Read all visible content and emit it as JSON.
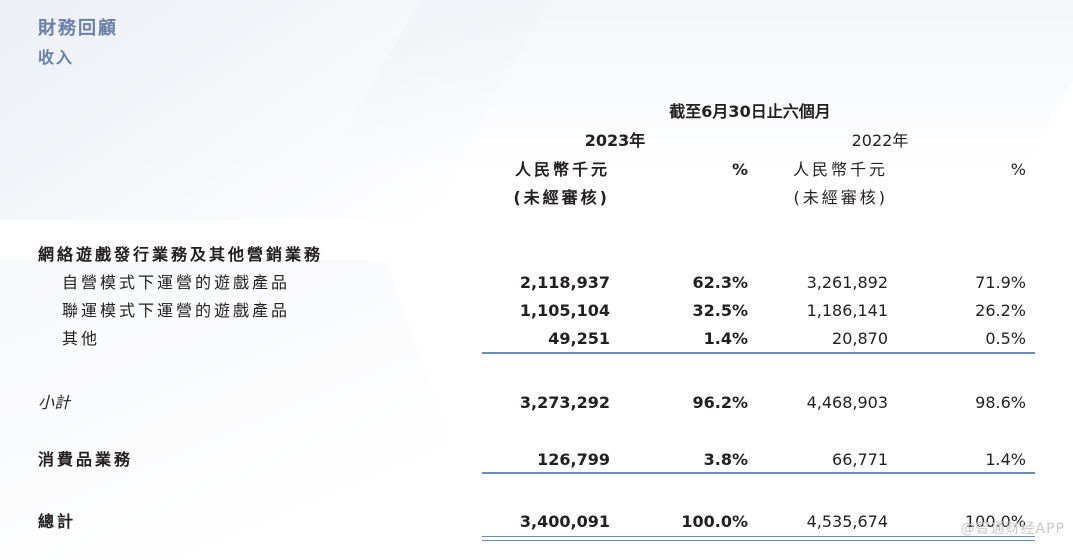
{
  "header": {
    "title": "財務回顧",
    "subtitle": "收入"
  },
  "table": {
    "period_header": "截至6月30日止六個月",
    "year_2023": "2023年",
    "year_2022": "2022年",
    "currency_label": "人民幣千元",
    "unaudited_label": "(未經審核)",
    "pct_label": "%",
    "section_label": "網絡遊戲發行業務及其他營銷業務",
    "rows": [
      {
        "label": "自營模式下運營的遊戲產品",
        "v2023": "2,118,937",
        "p2023": "62.3%",
        "v2022": "3,261,892",
        "p2022": "71.9%"
      },
      {
        "label": "聯運模式下運營的遊戲產品",
        "v2023": "1,105,104",
        "p2023": "32.5%",
        "v2022": "1,186,141",
        "p2022": "26.2%"
      },
      {
        "label": "其他",
        "v2023": "49,251",
        "p2023": "1.4%",
        "v2022": "20,870",
        "p2022": "0.5%"
      },
      {
        "label": "小計",
        "v2023": "3,273,292",
        "p2023": "96.2%",
        "v2022": "4,468,903",
        "p2022": "98.6%"
      },
      {
        "label": "消費品業務",
        "v2023": "126,799",
        "p2023": "3.8%",
        "v2022": "66,771",
        "p2022": "1.4%"
      },
      {
        "label": "總計",
        "v2023": "3,400,091",
        "p2023": "100.0%",
        "v2022": "4,535,674",
        "p2022": "100.0%"
      }
    ]
  },
  "watermark": "@智通财经APP"
}
